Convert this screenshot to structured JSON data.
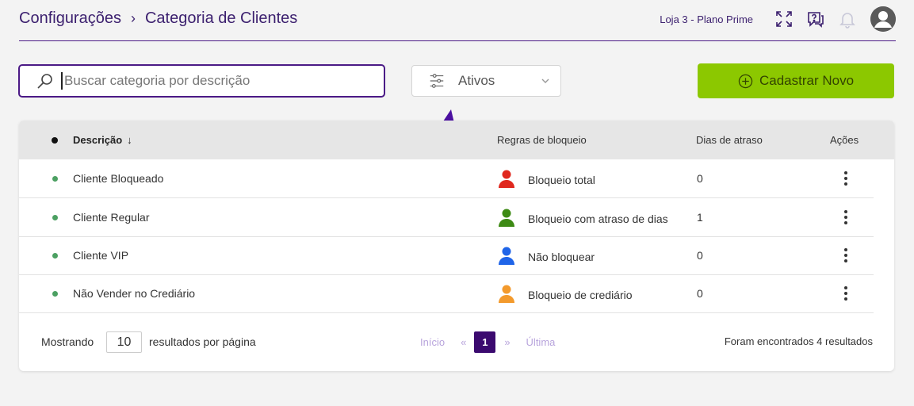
{
  "header": {
    "breadcrumb": [
      "Configurações",
      "Categoria de Clientes"
    ],
    "store_label": "Loja 3 - Plano Prime",
    "icons": [
      "expand-icon",
      "help-icon",
      "bell-icon",
      "user-avatar-icon"
    ]
  },
  "toolbar": {
    "search_placeholder": "Buscar categoria por descrição",
    "search_value": "",
    "filter_label": "Ativos",
    "new_button_label": "Cadastrar Novo"
  },
  "table": {
    "columns": {
      "description": "Descrição",
      "rules": "Regras de bloqueio",
      "delay_days": "Dias de atraso",
      "actions": "Ações"
    },
    "rows": [
      {
        "description": "Cliente Bloqueado",
        "rule": "Bloqueio total",
        "rule_color": "#e0281e",
        "days": "0"
      },
      {
        "description": "Cliente Regular",
        "rule": "Bloqueio com atraso de dias",
        "rule_color": "#3d8a14",
        "days": "1"
      },
      {
        "description": "Cliente VIP",
        "rule": "Não bloquear",
        "rule_color": "#1f64e8",
        "days": "0"
      },
      {
        "description": "Não Vender no Crediário",
        "rule": "Bloqueio de crediário",
        "rule_color": "#f39a2c",
        "days": "0"
      }
    ]
  },
  "footer": {
    "showing_label": "Mostrando",
    "per_page": "10",
    "per_page_label": "resultados por página",
    "pager": {
      "first": "Início",
      "prev": "«",
      "current": "1",
      "next": "»",
      "last": "Última"
    },
    "found_label": "Foram encontrados 4 resultados"
  },
  "colors": {
    "brand_purple": "#4b1a86",
    "new_button_green": "#8cc800",
    "active_dot_green": "#4ca062"
  }
}
